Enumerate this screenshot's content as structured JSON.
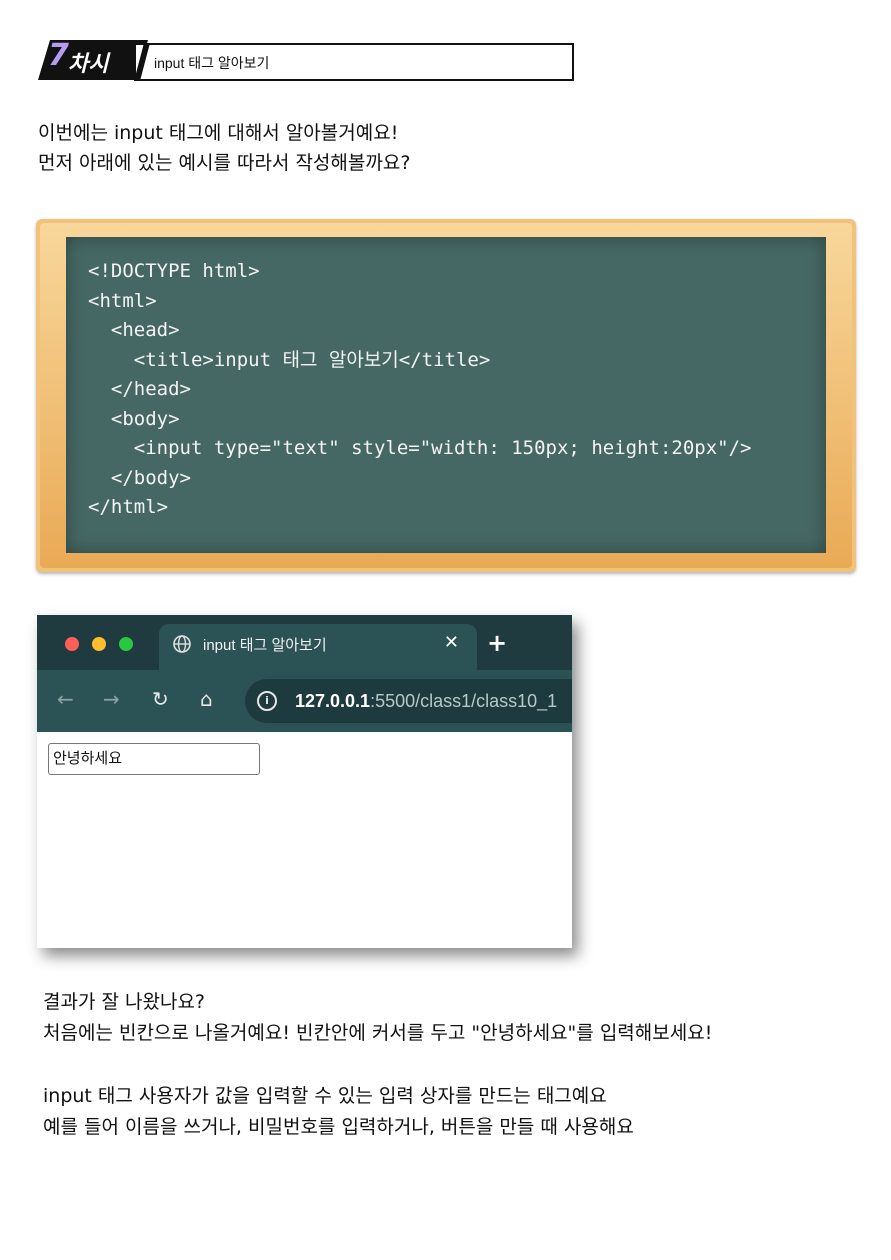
{
  "header": {
    "badge_number": "7",
    "badge_word": "차시",
    "title": "input 태그 알아보기"
  },
  "intro": {
    "line1": "이번에는 input 태그에 대해서 알아볼거예요!",
    "line2": "먼저 아래에 있는 예시를 따라서 작성해볼까요?"
  },
  "code_lines": [
    "<!DOCTYPE html>",
    "<html>",
    "  <head>",
    "    <title>input 태그 알아보기</title>",
    "  </head>",
    "  <body>",
    "    <input type=\"text\" style=\"width: 150px; height:20px\"/>",
    "  </body>",
    "</html>"
  ],
  "browser": {
    "tab_title": "input 태그 알아보기",
    "tab_close": "✕",
    "new_tab": "+",
    "url_host": "127.0.0.1",
    "url_path": ":5500/class1/class10_1",
    "input_value": "안녕하세요",
    "dots": [
      "#ff5f57",
      "#febc2e",
      "#28c840"
    ]
  },
  "result": {
    "line1": "결과가 잘 나왔나요?",
    "line2": "처음에는 빈칸으로 나올거예요! 빈칸안에 커서를 두고 \"안녕하세요\"를 입력해보세요!"
  },
  "summary": {
    "line1": "input 태그 사용자가 값을 입력할 수 있는 입력 상자를 만드는 태그예요",
    "line2": "예를 들어 이름을 쓰거나, 비밀번호를 입력하거나, 버튼을 만들 때 사용해요"
  }
}
